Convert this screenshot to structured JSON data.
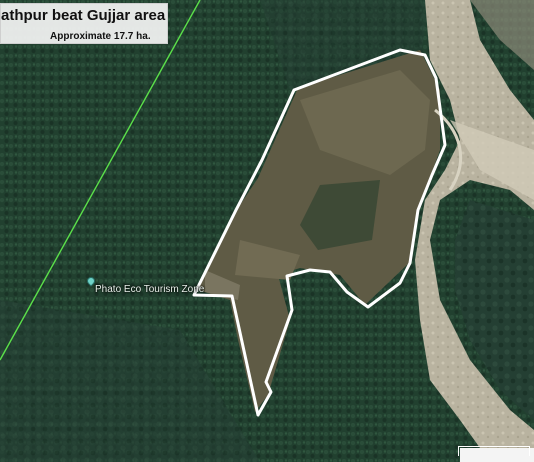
{
  "title": {
    "main": "athpur beat Gujjar area",
    "subtitle": "Approximate 17.7 ha."
  },
  "place": {
    "label": "Phato Eco Tourism Zone",
    "icon": "place-pin-icon"
  },
  "colors": {
    "forest": "#1f3a2e",
    "clearing": "#5d5a43",
    "riverbed": "#bfb9a7",
    "boundary": "#ffffff",
    "boundary_line": "#5be04a"
  }
}
